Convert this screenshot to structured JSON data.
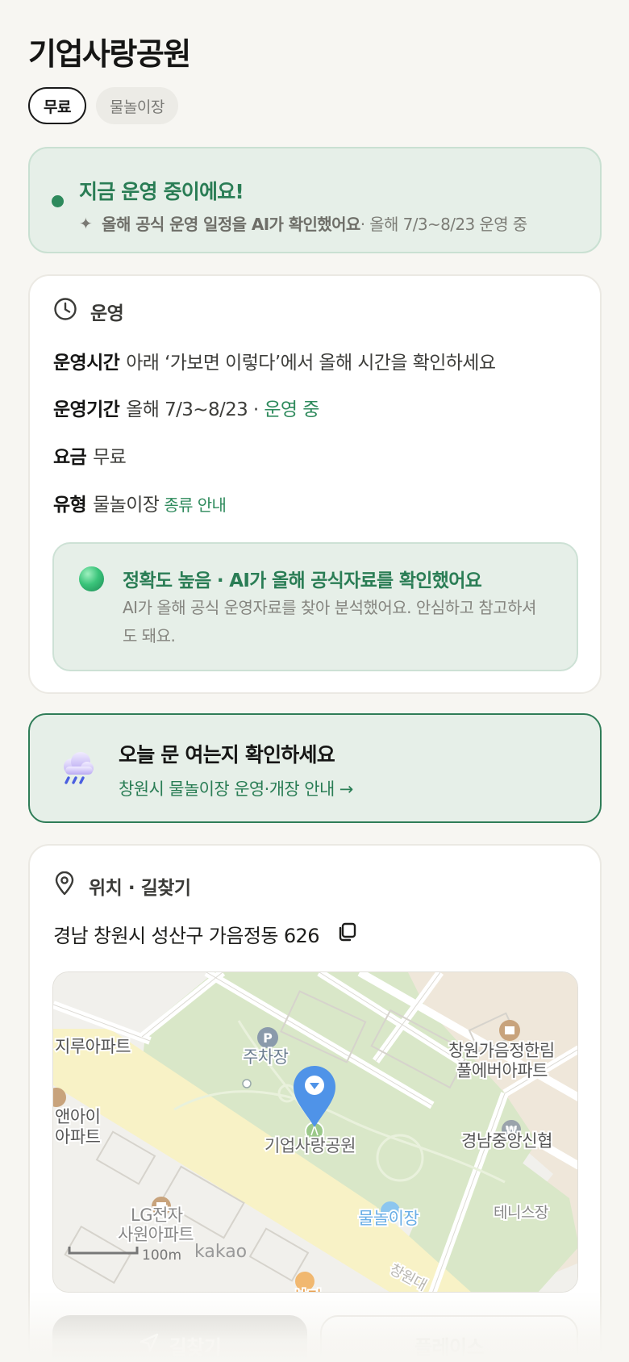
{
  "page": {
    "title": "기업사랑공원"
  },
  "chips": [
    {
      "label": "무료",
      "active": true
    },
    {
      "label": "물놀이장",
      "active": false
    }
  ],
  "status": {
    "title": "지금 운영 중이에요!",
    "ai_note": "올해 공식 운영 일정을 AI가 확인했어요",
    "period_note": " · 올해 7/3~8/23 운영 중",
    "color": "#2e8a5c"
  },
  "operation": {
    "heading": "운영",
    "hours_label": "운영시간",
    "hours_value": "아래 ‘가보면 이렇다’에서 올해 시간을 확인하세요",
    "period_label": "운영기간",
    "period_value": "올해 7/3~8/23 · ",
    "period_status": "운영 중",
    "fee_label": "요금",
    "fee_value": "무료",
    "type_label": "유형",
    "type_value": "물놀이장",
    "type_link": "종류 안내",
    "accuracy_title": "정확도 높음 · AI가 올해 공식자료를 확인했어요",
    "accuracy_body": "AI가 올해 공식 운영자료를 찾아 분석했어요. 안심하고 참고하셔도 돼요."
  },
  "notice": {
    "title": "오늘 문 여는지 확인하세요",
    "link": "창원시 물놀이장 운영·개장 안내 →",
    "icon": "rain-cloud-icon"
  },
  "location": {
    "heading": "위치 · 길찾기",
    "address": "경남 창원시 성산구 가음정동 626",
    "map_labels": {
      "apt_left_top": "지루아파트",
      "apt_left_mid_1": "앤아이",
      "apt_left_mid_2": "아파트",
      "parking": "주차장",
      "park": "기업사랑공원",
      "apt_right_1": "창원가음정한림",
      "apt_right_2": "풀에버아파트",
      "bank": "경남중앙신협",
      "lg_1": "LG전자",
      "lg_2": "사원아파트",
      "water_play": "물놀이장",
      "tennis": "테니스장",
      "road": "창원대",
      "shop": "상가",
      "scale": "100m",
      "brand": "kakao"
    },
    "buttons": {
      "directions": "길찾기",
      "place": "플레이스"
    }
  }
}
